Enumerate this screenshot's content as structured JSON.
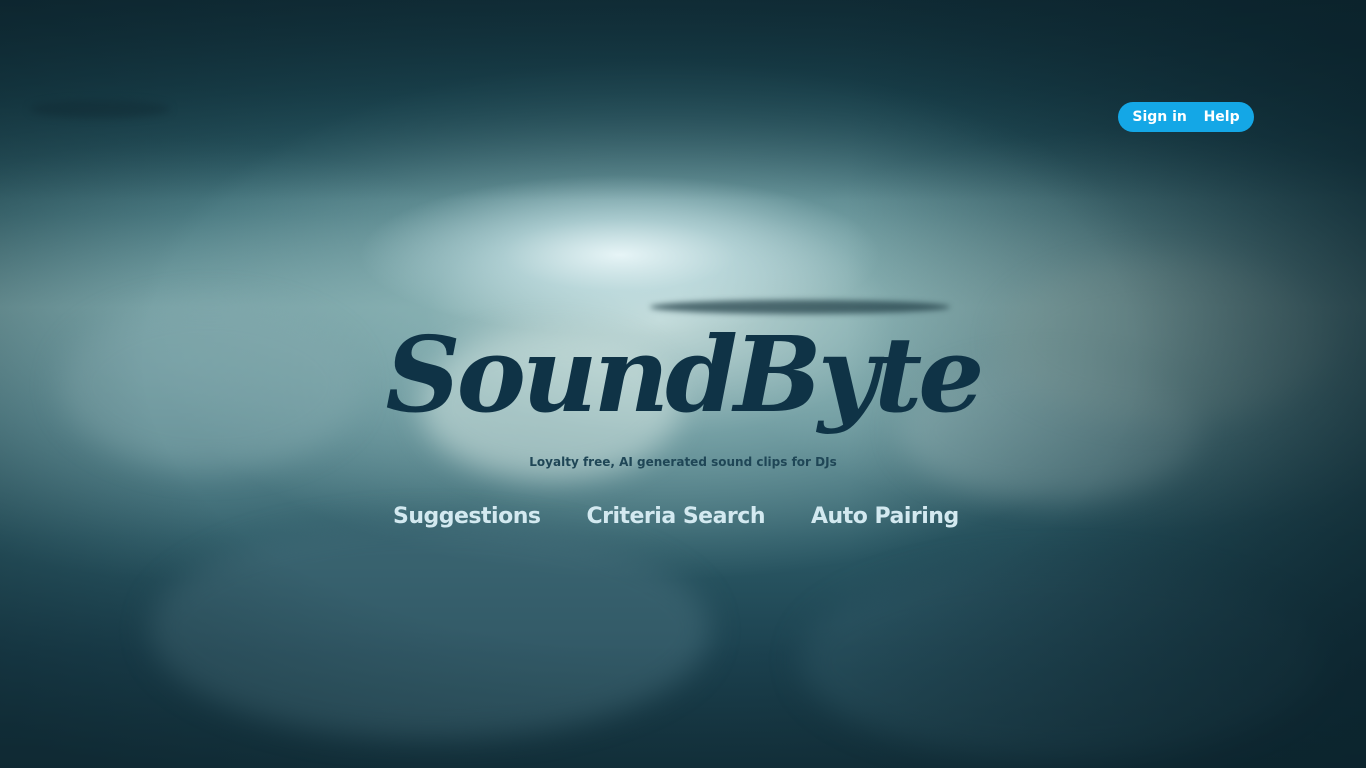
{
  "header": {
    "nav": {
      "sign_in_label": "Sign in",
      "help_label": "Help"
    }
  },
  "hero": {
    "logo_text": "SoundByte",
    "tagline": "Loyalty free, AI generated sound clips for DJs"
  },
  "features": {
    "links": [
      {
        "label": "Suggestions"
      },
      {
        "label": "Criteria Search"
      },
      {
        "label": "Auto Pairing"
      }
    ]
  },
  "colors": {
    "nav_pill": "#14a7e6",
    "logo": "#0f3346",
    "feature_link": "#d3e9f0"
  }
}
